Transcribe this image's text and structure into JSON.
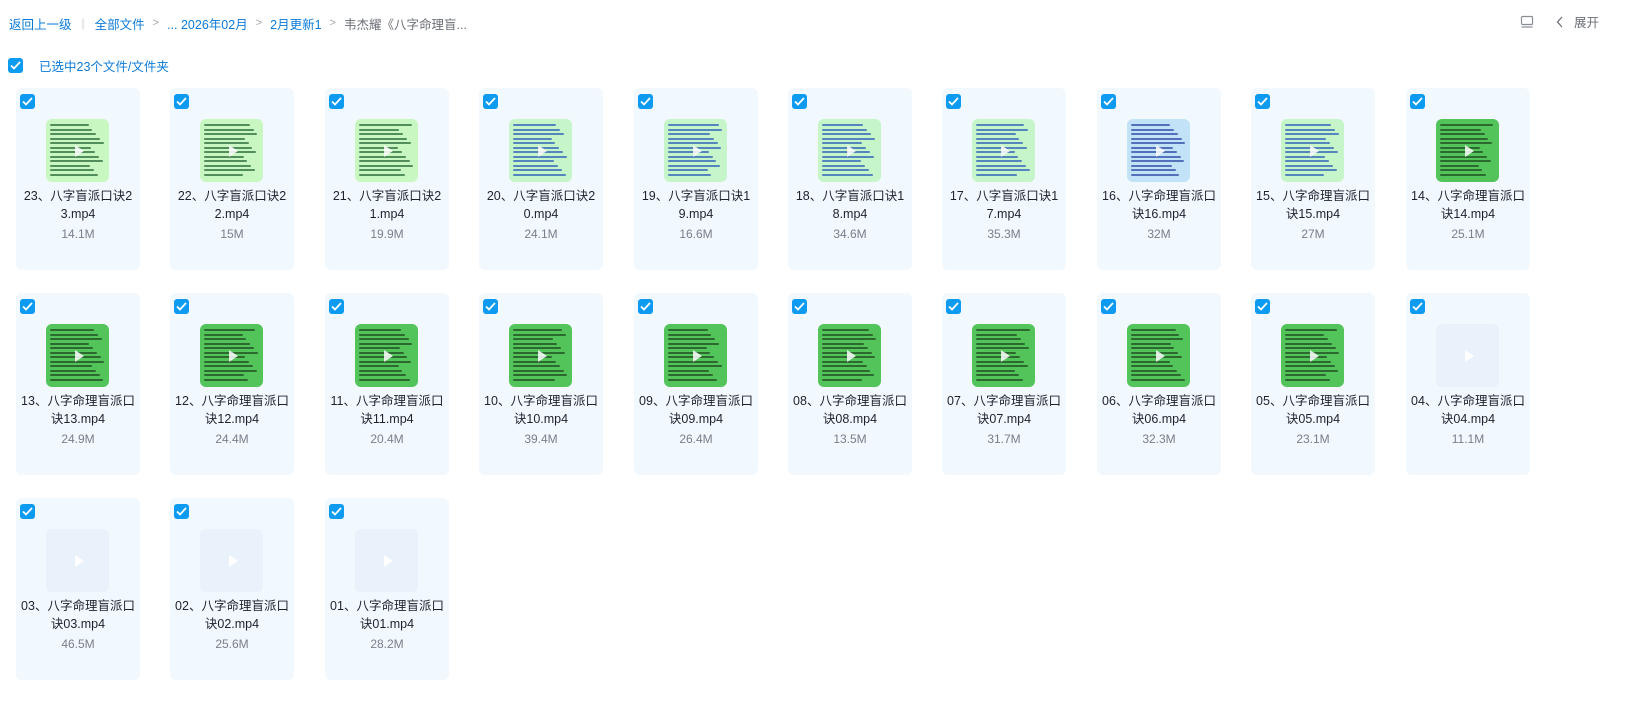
{
  "breadcrumb": {
    "back": "返回上一级",
    "all_files": "全部文件",
    "ellipsis_folder": "... 2026年02月",
    "folder": "2月更新1",
    "current": "韦杰耀《八字命理盲..."
  },
  "toolbar": {
    "expand_label": "展开"
  },
  "selection": {
    "label": "已选中23个文件/文件夹"
  },
  "colors": {
    "accent": "#0d9bf2",
    "link": "#0c7ad8",
    "card_bg": "#f1f8fe"
  },
  "files": [
    {
      "name": "23、八字盲派口诀23.mp4",
      "size": "14.1M",
      "thumb": "green-lines"
    },
    {
      "name": "22、八字盲派口诀22.mp4",
      "size": "15M",
      "thumb": "green-lines"
    },
    {
      "name": "21、八字盲派口诀21.mp4",
      "size": "19.9M",
      "thumb": "green-lines"
    },
    {
      "name": "20、八字盲派口诀20.mp4",
      "size": "24.1M",
      "thumb": "green-blue"
    },
    {
      "name": "19、八字盲派口诀19.mp4",
      "size": "16.6M",
      "thumb": "green-blue"
    },
    {
      "name": "18、八字盲派口诀18.mp4",
      "size": "34.6M",
      "thumb": "green-blue"
    },
    {
      "name": "17、八字盲派口诀17.mp4",
      "size": "35.3M",
      "thumb": "green-blue"
    },
    {
      "name": "16、八字命理盲派口诀16.mp4",
      "size": "32M",
      "thumb": "blue-dense"
    },
    {
      "name": "15、八字命理盲派口诀15.mp4",
      "size": "27M",
      "thumb": "green-blue"
    },
    {
      "name": "14、八字命理盲派口诀14.mp4",
      "size": "25.1M",
      "thumb": "green-dark"
    },
    {
      "name": "13、八字命理盲派口诀13.mp4",
      "size": "24.9M",
      "thumb": "green-dark"
    },
    {
      "name": "12、八字命理盲派口诀12.mp4",
      "size": "24.4M",
      "thumb": "green-dark"
    },
    {
      "name": "11、八字命理盲派口诀11.mp4",
      "size": "20.4M",
      "thumb": "green-dark"
    },
    {
      "name": "10、八字命理盲派口诀10.mp4",
      "size": "39.4M",
      "thumb": "green-dark"
    },
    {
      "name": "09、八字命理盲派口诀09.mp4",
      "size": "26.4M",
      "thumb": "green-dark"
    },
    {
      "name": "08、八字命理盲派口诀08.mp4",
      "size": "13.5M",
      "thumb": "green-dark"
    },
    {
      "name": "07、八字命理盲派口诀07.mp4",
      "size": "31.7M",
      "thumb": "green-dark"
    },
    {
      "name": "06、八字命理盲派口诀06.mp4",
      "size": "32.3M",
      "thumb": "green-dark"
    },
    {
      "name": "05、八字命理盲派口诀05.mp4",
      "size": "23.1M",
      "thumb": "green-dark"
    },
    {
      "name": "04、八字命理盲派口诀04.mp4",
      "size": "11.1M",
      "thumb": "pale"
    },
    {
      "name": "03、八字命理盲派口诀03.mp4",
      "size": "46.5M",
      "thumb": "pale"
    },
    {
      "name": "02、八字命理盲派口诀02.mp4",
      "size": "25.6M",
      "thumb": "pale"
    },
    {
      "name": "01、八字命理盲派口诀01.mp4",
      "size": "28.2M",
      "thumb": "pale"
    }
  ]
}
